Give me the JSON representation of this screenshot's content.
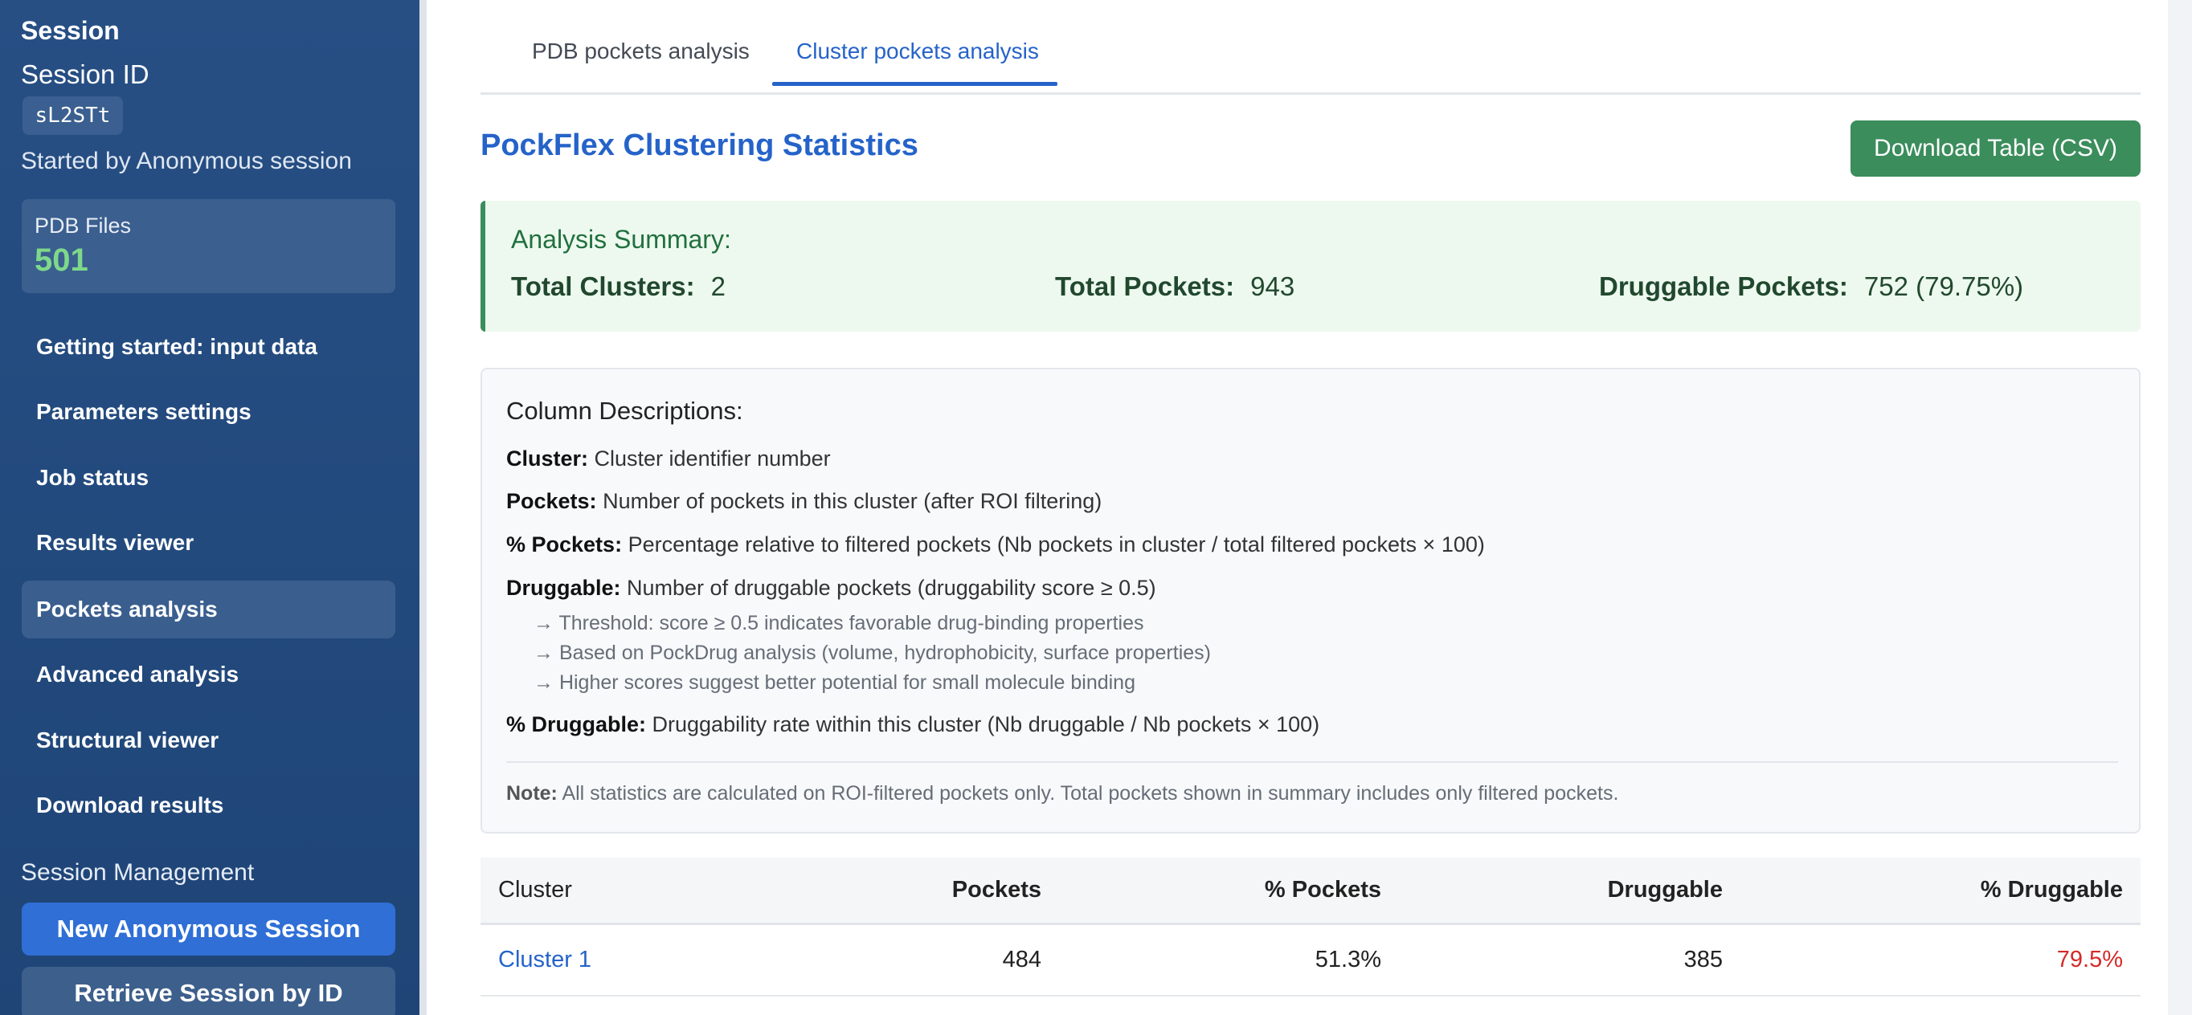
{
  "sidebar": {
    "heading": "Session",
    "session_id_label": "Session ID",
    "session_id": "sL2STt",
    "started_by": "Started by Anonymous session",
    "pdb_files_label": "PDB Files",
    "pdb_files_count": "501",
    "nav": [
      {
        "label": "Getting started: input data"
      },
      {
        "label": "Parameters settings"
      },
      {
        "label": "Job status"
      },
      {
        "label": "Results viewer"
      },
      {
        "label": "Pockets analysis",
        "active": true
      },
      {
        "label": "Advanced analysis"
      },
      {
        "label": "Structural viewer"
      },
      {
        "label": "Download results"
      }
    ],
    "management_label": "Session Management",
    "new_session_button": "New Anonymous Session",
    "retrieve_session_button": "Retrieve Session by ID"
  },
  "tabs": [
    {
      "label": "PDB pockets analysis"
    },
    {
      "label": "Cluster pockets analysis",
      "active": true
    }
  ],
  "stats": {
    "title": "PockFlex Clustering Statistics",
    "download_button": "Download Table (CSV)"
  },
  "summary": {
    "title": "Analysis Summary:",
    "total_clusters_label": "Total Clusters:",
    "total_clusters_value": "2",
    "total_pockets_label": "Total Pockets:",
    "total_pockets_value": "943",
    "druggable_label": "Druggable Pockets:",
    "druggable_value": "752 (79.75%)"
  },
  "descriptions": {
    "title": "Column Descriptions:",
    "cluster_term": "Cluster:",
    "cluster_text": " Cluster identifier number",
    "pockets_term": "Pockets:",
    "pockets_text": " Number of pockets in this cluster (after ROI filtering)",
    "pct_pockets_term": "% Pockets:",
    "pct_pockets_text": " Percentage relative to filtered pockets (Nb pockets in cluster / total filtered pockets × 100)",
    "druggable_term": "Druggable:",
    "druggable_text": " Number of druggable pockets (druggability score ≥ 0.5)",
    "sub1": "→ Threshold: score ≥ 0.5 indicates favorable drug-binding properties",
    "sub2": "→ Based on PockDrug analysis (volume, hydrophobicity, surface properties)",
    "sub3": "→ Higher scores suggest better potential for small molecule binding",
    "pct_druggable_term": "% Druggable:",
    "pct_druggable_text": " Druggability rate within this cluster (Nb druggable / Nb pockets × 100)",
    "note_term": "Note:",
    "note_text": " All statistics are calculated on ROI-filtered pockets only. Total pockets shown in summary includes only filtered pockets."
  },
  "table": {
    "headers": [
      "Cluster",
      "Pockets",
      "% Pockets",
      "Druggable",
      "% Druggable"
    ],
    "rows": [
      {
        "cluster": "Cluster 1",
        "pockets": "484",
        "pct_pockets": "51.3%",
        "druggable": "385",
        "pct_druggable": "79.5%"
      }
    ]
  }
}
